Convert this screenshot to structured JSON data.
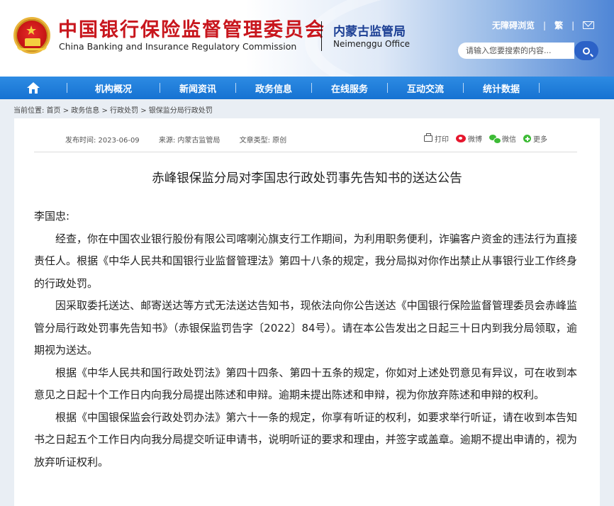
{
  "header": {
    "cn_title": "中国银行保险监督管理委员会",
    "en_title": "China Banking and Insurance Regulatory Commission",
    "bureau_cn": "内蒙古监管局",
    "bureau_en": "Neimenggu Office",
    "toplinks": {
      "accessibility": "无障碍浏览",
      "traditional": "繁"
    },
    "search_placeholder": "请输入您要搜索的内容..."
  },
  "nav": {
    "items": [
      "机构概况",
      "新闻资讯",
      "政务信息",
      "在线服务",
      "互动交流",
      "统计数据"
    ]
  },
  "breadcrumb": "当前位置:   首页 > 政务信息 > 行政处罚 > 银保监分局行政处罚",
  "article": {
    "meta": {
      "date": "发布时间:  2023-06-09",
      "source": "来源:  内蒙古监管局",
      "type": "文章类型:  原创"
    },
    "share": {
      "print": "打印",
      "weibo": "微博",
      "wechat": "微信",
      "more": "更多"
    },
    "title": "赤峰银保监分局对李国忠行政处罚事先告知书的送达公告",
    "salutation": "李国忠:",
    "paragraphs": [
      "经查，你在中国农业银行股份有限公司喀喇沁旗支行工作期间，为利用职务便利，诈骗客户资金的违法行为直接责任人。根据《中华人民共和国银行业监督管理法》第四十八条的规定，我分局拟对你作出禁止从事银行业工作终身的行政处罚。",
      "因采取委托送达、邮寄送达等方式无法送达告知书，现依法向你公告送达《中国银行保险监督管理委员会赤峰监管分局行政处罚事先告知书》（赤银保监罚告字〔2022〕84号）。请在本公告发出之日起三十日内到我分局领取，逾期视为送达。",
      "根据《中华人民共和国行政处罚法》第四十四条、第四十五条的规定，你如对上述处罚意见有异议，可在收到本意见之日起十个工作日内向我分局提出陈述和申辩。逾期未提出陈述和申辩，视为你放弃陈述和申辩的权利。",
      "根据《中国银保监会行政处罚办法》第六十一条的规定，你享有听证的权利，如要求举行听证，请在收到本告知书之日起五个工作日内向我分局提交听证申请书，说明听证的要求和理由，并签字或盖章。逾期不提出申请的，视为放弃听证权利。"
    ]
  },
  "colors": {
    "brand_red": "#c8161d",
    "nav_blue": "#1a78d8",
    "bureau_blue": "#1c3f94"
  },
  "icons": [
    "national-emblem",
    "mail-icon",
    "search-icon",
    "home-icon",
    "print-icon",
    "weibo-icon",
    "wechat-icon",
    "more-icon"
  ]
}
